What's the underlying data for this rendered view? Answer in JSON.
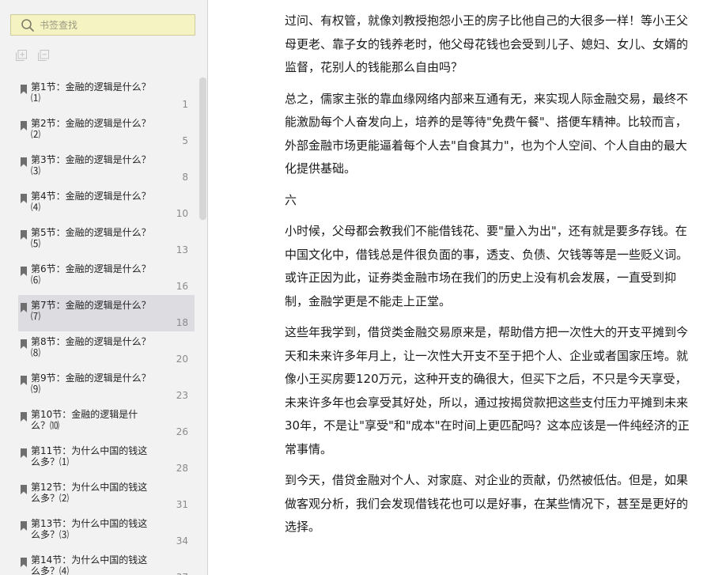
{
  "search": {
    "placeholder": "书签查找"
  },
  "toolbar": {
    "expand_icon": "expand-all-icon",
    "collapse_icon": "collapse-all-icon"
  },
  "toc": {
    "items": [
      {
        "title": "第1节：金融的逻辑是什么？⑴",
        "page": "1"
      },
      {
        "title": "第2节：金融的逻辑是什么？⑵",
        "page": "5"
      },
      {
        "title": "第3节：金融的逻辑是什么？⑶",
        "page": "8"
      },
      {
        "title": "第4节：金融的逻辑是什么？⑷",
        "page": "10"
      },
      {
        "title": "第5节：金融的逻辑是什么？⑸",
        "page": "13"
      },
      {
        "title": "第6节：金融的逻辑是什么？⑹",
        "page": "16"
      },
      {
        "title": "第7节：金融的逻辑是什么？⑺",
        "page": "18",
        "active": true
      },
      {
        "title": "第8节：金融的逻辑是什么？⑻",
        "page": "20"
      },
      {
        "title": "第9节：金融的逻辑是什么？⑼",
        "page": "23"
      },
      {
        "title": "第10节：金融的逻辑是什么？⑽",
        "page": "26"
      },
      {
        "title": "第11节：为什么中国的钱这么多？⑴",
        "page": "28"
      },
      {
        "title": "第12节：为什么中国的钱这么多？⑵",
        "page": "31"
      },
      {
        "title": "第13节：为什么中国的钱这么多？⑶",
        "page": "34"
      },
      {
        "title": "第14节：为什么中国的钱这么多？⑷",
        "page": "37"
      }
    ]
  },
  "article": {
    "paragraphs": [
      "过问、有权管，就像刘教授抱怨小王的房子比他自己的大很多一样！等小王父母更老、靠子女的钱养老时，他父母花钱也会受到儿子、媳妇、女儿、女婿的监督，花别人的钱能那么自由吗？",
      "总之，儒家主张的靠血缘网络内部来互通有无，来实现人际金融交易，最终不能激励每个人奋发向上，培养的是等待\"免费午餐\"、搭便车精神。比较而言，外部金融市场更能逼着每个人去\"自食其力\"，也为个人空间、个人自由的最大化提供基础。",
      "六",
      "小时候，父母都会教我们不能借钱花、要\"量入为出\"，还有就是要多存钱。在中国文化中，借钱总是件很负面的事，透支、负债、欠钱等等是一些贬义词。或许正因为此，证券类金融市场在我们的历史上没有机会发展，一直受到抑制，金融学更是不能走上正堂。",
      "这些年我学到，借贷类金融交易原来是，帮助借方把一次性大的开支平摊到今天和未来许多年月上，让一次性大开支不至于把个人、企业或者国家压垮。就像小王买房要120万元，这种开支的确很大，但买下之后，不只是今天享受，未来许多年也会享受其好处，所以，通过按揭贷款把这些支付压力平摊到未来30年，不是让\"享受\"和\"成本\"在时间上更匹配吗？这本应该是一件纯经济的正常事情。",
      "到今天，借贷金融对个人、对家庭、对企业的贡献，仍然被低估。但是，如果做客观分析，我们会发现借钱花也可以是好事，在某些情况下，甚至是更好的选择。"
    ]
  }
}
